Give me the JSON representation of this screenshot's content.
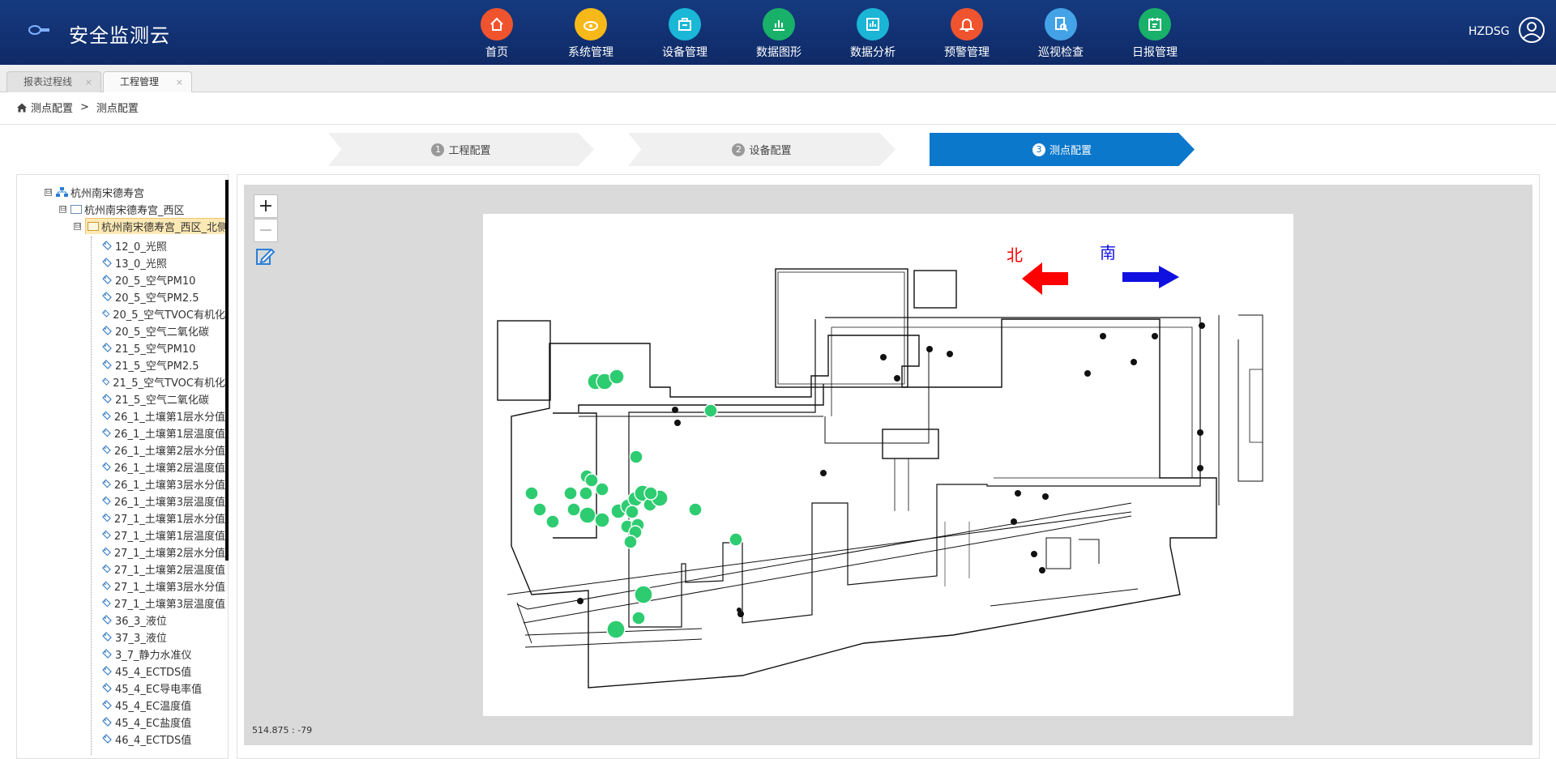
{
  "header": {
    "app_title": "安全监测云",
    "user": "HZDSG",
    "nav": [
      {
        "label": "首页",
        "color": "#f0542e",
        "icon": "home-icon"
      },
      {
        "label": "系统管理",
        "color": "#f6b919",
        "icon": "settings-cloud-icon"
      },
      {
        "label": "设备管理",
        "color": "#1ab7d7",
        "icon": "device-icon"
      },
      {
        "label": "数据图形",
        "color": "#19b06a",
        "icon": "chart-icon"
      },
      {
        "label": "数据分析",
        "color": "#1bb5d6",
        "icon": "analysis-icon"
      },
      {
        "label": "预警管理",
        "color": "#f0542e",
        "icon": "bell-icon"
      },
      {
        "label": "巡视检查",
        "color": "#43a3e6",
        "icon": "inspection-icon"
      },
      {
        "label": "日报管理",
        "color": "#19b06a",
        "icon": "calendar-icon"
      }
    ]
  },
  "tabs": [
    {
      "label": "报表过程线",
      "close": "×"
    },
    {
      "label": "工程管理",
      "close": "×"
    }
  ],
  "breadcrumb": {
    "home": "测点配置",
    "sep": ">",
    "current": "测点配置"
  },
  "steps": [
    {
      "num": "1",
      "label": "工程配置"
    },
    {
      "num": "2",
      "label": "设备配置"
    },
    {
      "num": "3",
      "label": "测点配置"
    }
  ],
  "tree": {
    "root": "杭州南宋德寿宫",
    "zone": "杭州南宋德寿宫_西区",
    "selected": "杭州南宋德寿宫_西区_北侧",
    "toggle_symbol": "⊟",
    "points": [
      "12_0_光照",
      "13_0_光照",
      "20_5_空气PM10",
      "20_5_空气PM2.5",
      "20_5_空气TVOC有机化",
      "20_5_空气二氧化碳",
      "21_5_空气PM10",
      "21_5_空气PM2.5",
      "21_5_空气TVOC有机化",
      "21_5_空气二氧化碳",
      "26_1_土壤第1层水分值",
      "26_1_土壤第1层温度值",
      "26_1_土壤第2层水分值",
      "26_1_土壤第2层温度值",
      "26_1_土壤第3层水分值",
      "26_1_土壤第3层温度值",
      "27_1_土壤第1层水分值",
      "27_1_土壤第1层温度值",
      "27_1_土壤第2层水分值",
      "27_1_土壤第2层温度值",
      "27_1_土壤第3层水分值",
      "27_1_土壤第3层温度值",
      "36_3_液位",
      "37_3_液位",
      "3_7_静力水准仪",
      "45_4_ECTDS值",
      "45_4_EC导电率值",
      "45_4_EC温度值",
      "45_4_EC盐度值",
      "46_4_ECTDS值"
    ]
  },
  "map": {
    "zoom_in": "+",
    "zoom_out": "−",
    "north_label": "北",
    "south_label": "南",
    "north_color": "#ff0000",
    "south_color": "#1010e0",
    "marker_color": "#2ecc71",
    "coords": "514.875 : -79"
  }
}
